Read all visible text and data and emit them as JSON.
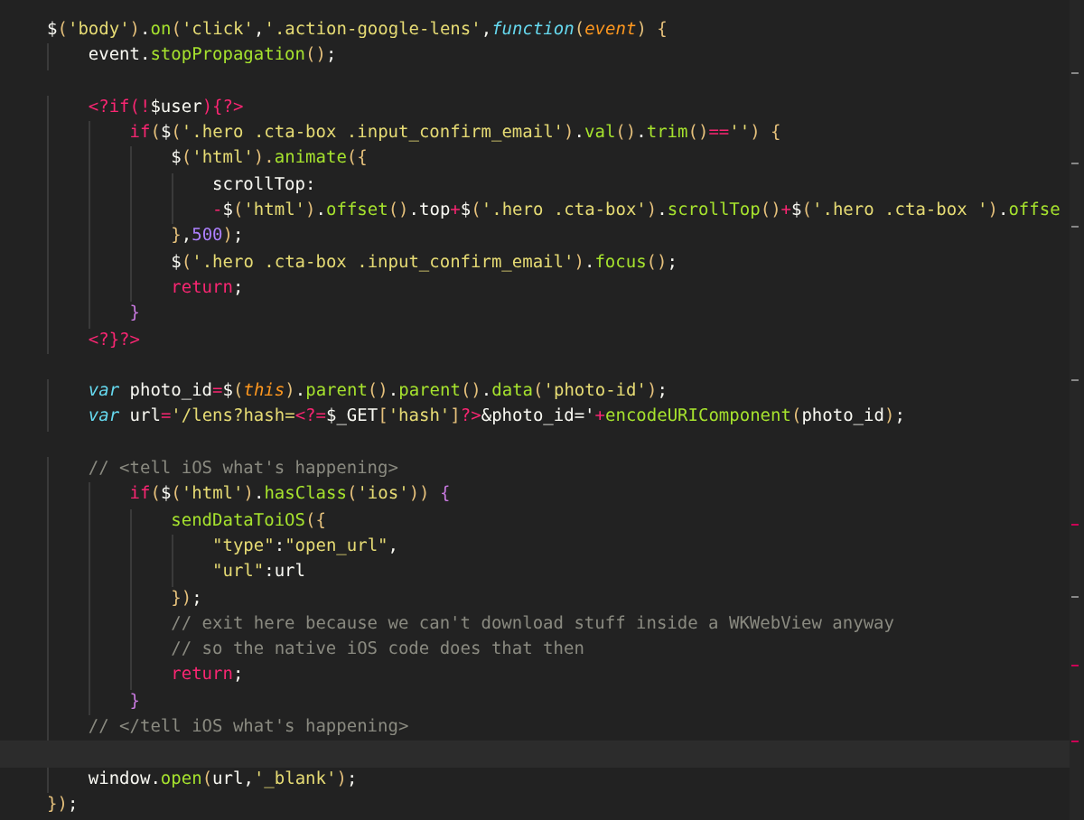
{
  "editor": {
    "lines": [
      {
        "current": false,
        "tokens": [
          {
            "kind": "plain",
            "text": "$"
          },
          {
            "kind": "bracket",
            "text": "("
          },
          {
            "kind": "string",
            "text": "'body'"
          },
          {
            "kind": "bracket",
            "text": ")"
          },
          {
            "kind": "plain",
            "text": "."
          },
          {
            "kind": "func",
            "text": "on"
          },
          {
            "kind": "bracket",
            "text": "("
          },
          {
            "kind": "string",
            "text": "'click'"
          },
          {
            "kind": "plain",
            "text": ","
          },
          {
            "kind": "string",
            "text": "'.action-google-lens'"
          },
          {
            "kind": "plain",
            "text": ","
          },
          {
            "kind": "storage",
            "text": "function"
          },
          {
            "kind": "bracket",
            "text": "("
          },
          {
            "kind": "param",
            "text": "event"
          },
          {
            "kind": "bracket",
            "text": ") {"
          }
        ]
      },
      {
        "current": false,
        "tokens": [
          {
            "kind": "plain",
            "text": "    event."
          },
          {
            "kind": "func",
            "text": "stopPropagation"
          },
          {
            "kind": "bracket",
            "text": "()"
          },
          {
            "kind": "plain",
            "text": ";"
          }
        ]
      },
      {
        "current": false
      },
      {
        "current": false,
        "tokens": [
          {
            "kind": "php",
            "text": "    <?if(!"
          },
          {
            "kind": "plain",
            "text": "$user"
          },
          {
            "kind": "php",
            "text": "){?>"
          }
        ]
      },
      {
        "current": false,
        "tokens": [
          {
            "kind": "keyword",
            "text": "        if"
          },
          {
            "kind": "bracket",
            "text": "("
          },
          {
            "kind": "plain",
            "text": "$"
          },
          {
            "kind": "bracket",
            "text": "("
          },
          {
            "kind": "string",
            "text": "'.hero .cta-box .input_confirm_email'"
          },
          {
            "kind": "bracket",
            "text": ")"
          },
          {
            "kind": "plain",
            "text": "."
          },
          {
            "kind": "func",
            "text": "val"
          },
          {
            "kind": "bracket",
            "text": "()"
          },
          {
            "kind": "plain",
            "text": "."
          },
          {
            "kind": "func",
            "text": "trim"
          },
          {
            "kind": "bracket",
            "text": "()"
          },
          {
            "kind": "operator",
            "text": "=="
          },
          {
            "kind": "string",
            "text": "''"
          },
          {
            "kind": "bracket",
            "text": ") {"
          }
        ]
      },
      {
        "current": false,
        "tokens": [
          {
            "kind": "plain",
            "text": "            $"
          },
          {
            "kind": "bracket",
            "text": "("
          },
          {
            "kind": "string",
            "text": "'html'"
          },
          {
            "kind": "bracket",
            "text": ")."
          },
          {
            "kind": "func",
            "text": "animate"
          },
          {
            "kind": "bracket",
            "text": "({"
          }
        ]
      },
      {
        "current": false,
        "tokens": [
          {
            "kind": "plain",
            "text": "                scrollTop:"
          }
        ]
      },
      {
        "current": false,
        "tokens": [
          {
            "kind": "operator",
            "text": "                -"
          },
          {
            "kind": "plain",
            "text": "$"
          },
          {
            "kind": "bracket",
            "text": "("
          },
          {
            "kind": "string",
            "text": "'html'"
          },
          {
            "kind": "bracket",
            "text": ")"
          },
          {
            "kind": "plain",
            "text": "."
          },
          {
            "kind": "func",
            "text": "offset"
          },
          {
            "kind": "bracket",
            "text": "()"
          },
          {
            "kind": "plain",
            "text": ".top"
          },
          {
            "kind": "operator",
            "text": "+"
          },
          {
            "kind": "plain",
            "text": "$"
          },
          {
            "kind": "bracket",
            "text": "("
          },
          {
            "kind": "string",
            "text": "'.hero .cta-box'"
          },
          {
            "kind": "bracket",
            "text": ")"
          },
          {
            "kind": "plain",
            "text": "."
          },
          {
            "kind": "func",
            "text": "scrollTop"
          },
          {
            "kind": "bracket",
            "text": "()"
          },
          {
            "kind": "operator",
            "text": "+"
          },
          {
            "kind": "plain",
            "text": "$"
          },
          {
            "kind": "bracket",
            "text": "("
          },
          {
            "kind": "string",
            "text": "'.hero .cta-box '"
          },
          {
            "kind": "bracket",
            "text": ")"
          },
          {
            "kind": "plain",
            "text": "."
          },
          {
            "kind": "func",
            "text": "offse"
          }
        ]
      },
      {
        "current": false,
        "tokens": [
          {
            "kind": "bracket",
            "text": "            }"
          },
          {
            "kind": "plain",
            "text": ","
          },
          {
            "kind": "number",
            "text": "500"
          },
          {
            "kind": "bracket",
            "text": ")"
          },
          {
            "kind": "plain",
            "text": ";"
          }
        ]
      },
      {
        "current": false,
        "tokens": [
          {
            "kind": "plain",
            "text": "            $"
          },
          {
            "kind": "bracket",
            "text": "("
          },
          {
            "kind": "string",
            "text": "'.hero .cta-box .input_confirm_email'"
          },
          {
            "kind": "bracket",
            "text": ")"
          },
          {
            "kind": "plain",
            "text": "."
          },
          {
            "kind": "func",
            "text": "focus"
          },
          {
            "kind": "bracket",
            "text": "()"
          },
          {
            "kind": "plain",
            "text": ";"
          }
        ]
      },
      {
        "current": false,
        "tokens": [
          {
            "kind": "keyword",
            "text": "            return"
          },
          {
            "kind": "plain",
            "text": ";"
          }
        ]
      },
      {
        "current": false,
        "tokens": [
          {
            "kind": "brace",
            "text": "        }"
          }
        ]
      },
      {
        "current": false,
        "tokens": [
          {
            "kind": "php",
            "text": "    <?}?>"
          }
        ]
      },
      {
        "current": false
      },
      {
        "current": false,
        "tokens": [
          {
            "kind": "storage",
            "text": "    var"
          },
          {
            "kind": "plain",
            "text": " photo_id"
          },
          {
            "kind": "operator",
            "text": "="
          },
          {
            "kind": "plain",
            "text": "$"
          },
          {
            "kind": "bracket",
            "text": "("
          },
          {
            "kind": "param",
            "text": "this"
          },
          {
            "kind": "bracket",
            "text": ")"
          },
          {
            "kind": "plain",
            "text": "."
          },
          {
            "kind": "func",
            "text": "parent"
          },
          {
            "kind": "bracket",
            "text": "()"
          },
          {
            "kind": "plain",
            "text": "."
          },
          {
            "kind": "func",
            "text": "parent"
          },
          {
            "kind": "bracket",
            "text": "()"
          },
          {
            "kind": "plain",
            "text": "."
          },
          {
            "kind": "func",
            "text": "data"
          },
          {
            "kind": "bracket",
            "text": "("
          },
          {
            "kind": "string",
            "text": "'photo-id'"
          },
          {
            "kind": "bracket",
            "text": ")"
          },
          {
            "kind": "plain",
            "text": ";"
          }
        ]
      },
      {
        "current": false,
        "tokens": [
          {
            "kind": "storage",
            "text": "    var"
          },
          {
            "kind": "plain",
            "text": " url"
          },
          {
            "kind": "operator",
            "text": "="
          },
          {
            "kind": "string",
            "text": "'/lens?hash="
          },
          {
            "kind": "php",
            "text": "<?="
          },
          {
            "kind": "plain",
            "text": "$_GET"
          },
          {
            "kind": "bracket",
            "text": "["
          },
          {
            "kind": "string",
            "text": "'hash'"
          },
          {
            "kind": "bracket",
            "text": "]"
          },
          {
            "kind": "php",
            "text": "?>"
          },
          {
            "kind": "plain",
            "text": "&photo_id='"
          },
          {
            "kind": "operator",
            "text": "+"
          },
          {
            "kind": "func",
            "text": "encodeURIComponent"
          },
          {
            "kind": "bracket",
            "text": "("
          },
          {
            "kind": "plain",
            "text": "photo_id"
          },
          {
            "kind": "bracket",
            "text": ")"
          },
          {
            "kind": "plain",
            "text": ";"
          }
        ]
      },
      {
        "current": false
      },
      {
        "current": false,
        "tokens": [
          {
            "kind": "comment",
            "text": "    // <tell iOS what's happening>"
          }
        ]
      },
      {
        "current": false,
        "tokens": [
          {
            "kind": "keyword",
            "text": "        if"
          },
          {
            "kind": "bracket",
            "text": "("
          },
          {
            "kind": "plain",
            "text": "$"
          },
          {
            "kind": "bracket",
            "text": "("
          },
          {
            "kind": "string",
            "text": "'html'"
          },
          {
            "kind": "bracket",
            "text": ")"
          },
          {
            "kind": "plain",
            "text": "."
          },
          {
            "kind": "func",
            "text": "hasClass"
          },
          {
            "kind": "bracket",
            "text": "("
          },
          {
            "kind": "string",
            "text": "'ios'"
          },
          {
            "kind": "bracket",
            "text": "))"
          },
          {
            "kind": "brace",
            "text": " {"
          }
        ]
      },
      {
        "current": false,
        "tokens": [
          {
            "kind": "func",
            "text": "            sendDataToiOS"
          },
          {
            "kind": "bracket",
            "text": "({"
          }
        ]
      },
      {
        "current": false,
        "tokens": [
          {
            "kind": "string",
            "text": "                \"type\""
          },
          {
            "kind": "plain",
            "text": ":"
          },
          {
            "kind": "string",
            "text": "\"open_url\""
          },
          {
            "kind": "plain",
            "text": ","
          }
        ]
      },
      {
        "current": false,
        "tokens": [
          {
            "kind": "string",
            "text": "                \"url\""
          },
          {
            "kind": "plain",
            "text": ":url"
          }
        ]
      },
      {
        "current": false,
        "tokens": [
          {
            "kind": "bracket",
            "text": "            })"
          },
          {
            "kind": "plain",
            "text": ";"
          }
        ]
      },
      {
        "current": false,
        "tokens": [
          {
            "kind": "comment",
            "text": "            // exit here because we can't download stuff inside a WKWebView anyway"
          }
        ]
      },
      {
        "current": false,
        "tokens": [
          {
            "kind": "comment",
            "text": "            // so the native iOS code does that then"
          }
        ]
      },
      {
        "current": false,
        "tokens": [
          {
            "kind": "keyword",
            "text": "            return"
          },
          {
            "kind": "plain",
            "text": ";"
          }
        ]
      },
      {
        "current": false,
        "tokens": [
          {
            "kind": "brace",
            "text": "        }"
          }
        ]
      },
      {
        "current": false,
        "tokens": [
          {
            "kind": "comment",
            "text": "    // </tell iOS what's happening>"
          }
        ]
      },
      {
        "current": true
      },
      {
        "current": false,
        "tokens": [
          {
            "kind": "plain",
            "text": "    window."
          },
          {
            "kind": "func",
            "text": "open"
          },
          {
            "kind": "bracket",
            "text": "("
          },
          {
            "kind": "plain",
            "text": "url,"
          },
          {
            "kind": "string",
            "text": "'_blank'"
          },
          {
            "kind": "bracket",
            "text": ")"
          },
          {
            "kind": "plain",
            "text": ";"
          }
        ]
      },
      {
        "current": false,
        "tokens": [
          {
            "kind": "bracket",
            "text": "})"
          },
          {
            "kind": "plain",
            "text": ";"
          }
        ]
      }
    ]
  }
}
